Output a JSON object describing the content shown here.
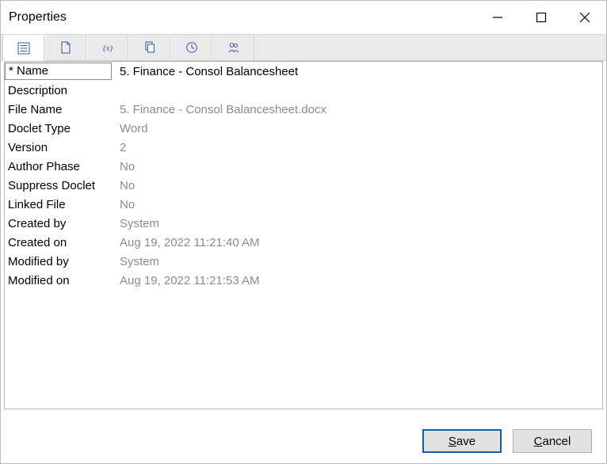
{
  "window": {
    "title": "Properties"
  },
  "tabs": [
    {
      "name": "properties-tab",
      "icon": "properties-list-icon",
      "active": true
    },
    {
      "name": "doclet-tab",
      "icon": "page-icon",
      "active": false
    },
    {
      "name": "variables-tab",
      "icon": "variable-x-icon",
      "active": false
    },
    {
      "name": "copy-tab",
      "icon": "copy-page-icon",
      "active": false
    },
    {
      "name": "history-tab",
      "icon": "clock-icon",
      "active": false
    },
    {
      "name": "actors-tab",
      "icon": "users-icon",
      "active": false
    }
  ],
  "properties": {
    "name": {
      "label": "* Name",
      "value": "5. Finance - Consol Balancesheet",
      "readonly": false
    },
    "description": {
      "label": "Description",
      "value": "",
      "readonly": false
    },
    "file_name": {
      "label": "File Name",
      "value": "5. Finance - Consol Balancesheet.docx",
      "readonly": true
    },
    "doclet_type": {
      "label": "Doclet Type",
      "value": "Word",
      "readonly": true
    },
    "version": {
      "label": "Version",
      "value": "2",
      "readonly": true
    },
    "author_phase": {
      "label": "Author Phase",
      "value": "No",
      "readonly": true
    },
    "suppress_doclet": {
      "label": "Suppress Doclet",
      "value": "No",
      "readonly": true
    },
    "linked_file": {
      "label": "Linked File",
      "value": "No",
      "readonly": true
    },
    "created_by": {
      "label": "Created by",
      "value": "System",
      "readonly": true
    },
    "created_on": {
      "label": "Created on",
      "value": "Aug 19, 2022 11:21:40 AM",
      "readonly": true
    },
    "modified_by": {
      "label": "Modified by",
      "value": "System",
      "readonly": true
    },
    "modified_on": {
      "label": "Modified on",
      "value": "Aug 19, 2022 11:21:53 AM",
      "readonly": true
    }
  },
  "buttons": {
    "save": "Save",
    "cancel": "Cancel"
  }
}
